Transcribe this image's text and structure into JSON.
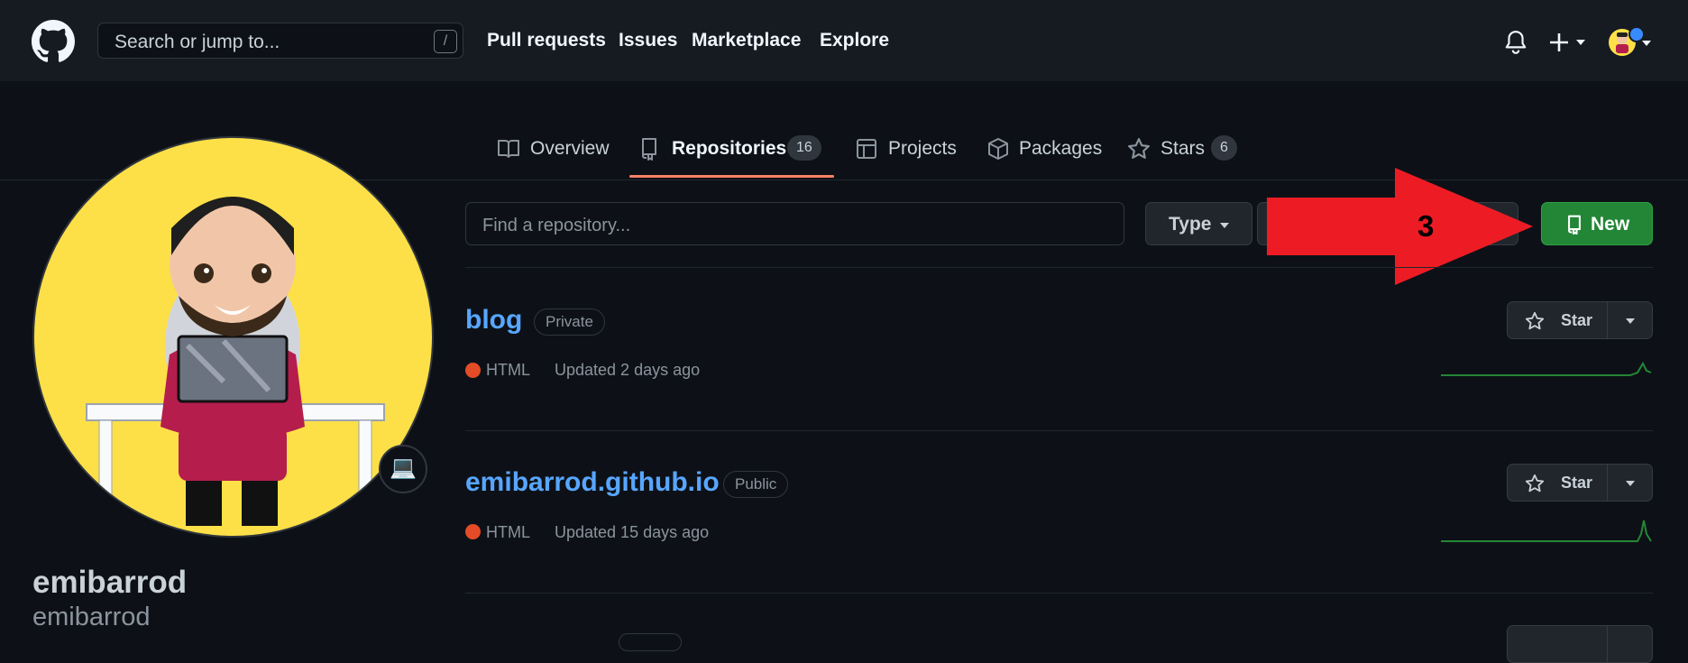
{
  "header": {
    "search_placeholder": "Search or jump to...",
    "search_shortcut": "/",
    "nav": [
      "Pull requests",
      "Issues",
      "Marketplace",
      "Explore"
    ]
  },
  "tabs": [
    {
      "label": "Overview"
    },
    {
      "label": "Repositories",
      "count": "16"
    },
    {
      "label": "Projects"
    },
    {
      "label": "Packages"
    },
    {
      "label": "Stars",
      "count": "6"
    }
  ],
  "profile": {
    "name": "emibarrod",
    "login": "emibarrod",
    "status_emoji": "💻"
  },
  "controls": {
    "find_placeholder": "Find a repository...",
    "type_label": "Type",
    "new_label": "New"
  },
  "repos": [
    {
      "name": "blog",
      "visibility": "Private",
      "language": "HTML",
      "updated": "Updated 2 days ago",
      "star_label": "Star"
    },
    {
      "name": "emibarrod.github.io",
      "visibility": "Public",
      "language": "HTML",
      "updated": "Updated 15 days ago",
      "star_label": "Star"
    }
  ],
  "annotation": {
    "label": "3"
  },
  "colors": {
    "accent_tab": "#f78166",
    "new_button": "#238636",
    "link": "#58a6ff",
    "html_lang": "#e34c26",
    "annotation_arrow": "#ed1c24"
  }
}
